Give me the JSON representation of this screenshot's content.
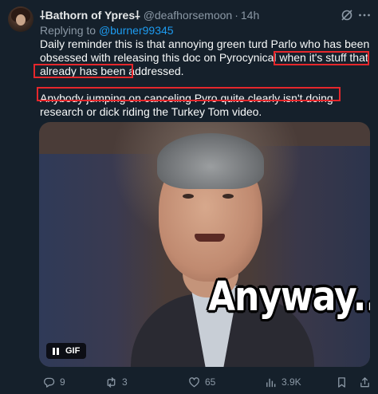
{
  "tweet": {
    "display_name": "⸸Bathorn of Ypres⸸",
    "handle": "@deafhorsemoon",
    "separator": "·",
    "time": "14h",
    "reply_prefix": "Replying to",
    "reply_mention": "@burner99345",
    "paragraph1": "Daily reminder this is that annoying green turd Parlo who has been obsessed with releasing this doc on Pyrocynical when it's stuff that already has been addressed.",
    "paragraph2": "Anybody jumping on canceling Pyro quite clearly isn't doing research or dick riding the Turkey Tom video.",
    "media": {
      "caption": "Anyway...",
      "badge": "GIF"
    },
    "actions": {
      "replies": "9",
      "reposts": "3",
      "likes": "65",
      "views": "3.9K"
    }
  },
  "colors": {
    "background": "#15202b",
    "accent": "#1d9bf0",
    "muted": "#8b98a5",
    "highlight_box": "#e5272c"
  },
  "icons": [
    "grok-icon",
    "more-icon",
    "reply-icon",
    "repost-icon",
    "like-icon",
    "views-icon",
    "bookmark-icon",
    "share-icon",
    "pause-icon"
  ]
}
